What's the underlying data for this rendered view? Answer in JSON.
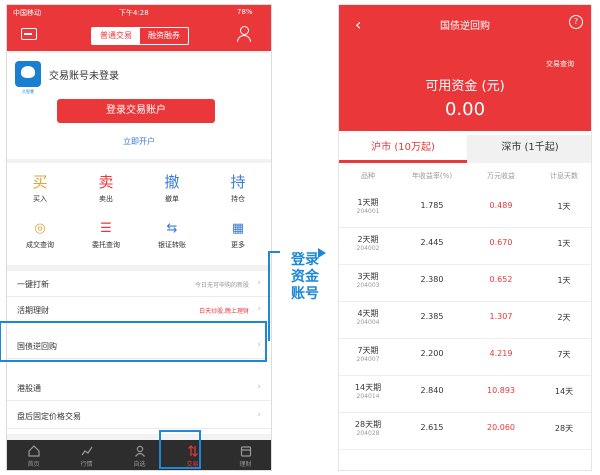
{
  "left": {
    "status": {
      "carrier": "中国移动",
      "time": "下午4:28",
      "battery": "78%"
    },
    "header": {
      "seg_normal": "普通交易",
      "seg_margin": "融资融券"
    },
    "account": {
      "logo_text": "大智慧",
      "title": "交易账号未登录",
      "login_button": "登录交易账户",
      "open_account": "立即开户"
    },
    "grid": [
      {
        "glyph": "买",
        "label": "买入",
        "color": "#e0a43a"
      },
      {
        "glyph": "卖",
        "label": "卖出",
        "color": "#e9373a"
      },
      {
        "glyph": "撤",
        "label": "撤单",
        "color": "#3b79d6"
      },
      {
        "glyph": "持",
        "label": "持仓",
        "color": "#3b79d6"
      },
      {
        "glyph": "◎",
        "label": "成交查询",
        "color": "#e0a43a"
      },
      {
        "glyph": "☰",
        "label": "委托查询",
        "color": "#e9373a"
      },
      {
        "glyph": "⇆",
        "label": "银证转账",
        "color": "#3b79d6"
      },
      {
        "glyph": "▦",
        "label": "更多",
        "color": "#3b79d6"
      }
    ],
    "list": [
      {
        "label": "一键打新",
        "hint": "今日无可申购的新股",
        "hint_red": false
      },
      {
        "label": "活期理财",
        "hint": "白天炒股,晚上理财",
        "hint_red": true
      },
      {
        "label": "国债逆回购",
        "hint": "",
        "hint_red": false
      },
      {
        "label": "港股通",
        "hint": "",
        "hint_red": false
      },
      {
        "label": "盘后固定价格交易",
        "hint": "",
        "hint_red": false
      }
    ],
    "tabs": [
      {
        "label": "首页",
        "icon": "home-icon"
      },
      {
        "label": "行情",
        "icon": "chart-icon"
      },
      {
        "label": "自选",
        "icon": "person-icon"
      },
      {
        "label": "交易",
        "icon": "trade-icon"
      },
      {
        "label": "理财",
        "icon": "wallet-icon"
      }
    ]
  },
  "annotation": {
    "caption_lines": [
      "登录",
      "资金",
      "账号"
    ],
    "accent": "#1e88d6"
  },
  "right": {
    "title": "国债逆回购",
    "help": "?",
    "query": "交易查询",
    "available_label": "可用资金 (元)",
    "available_value": "0.00",
    "market_tabs": [
      "沪市 (10万起)",
      "深市 (1千起)"
    ],
    "columns": [
      "品种",
      "年收益率(%)",
      "万元收益",
      "计息天数"
    ],
    "rows": [
      {
        "name": "1天期",
        "code": "204001",
        "rate": "1.785",
        "profit": "0.489",
        "days": "1天"
      },
      {
        "name": "2天期",
        "code": "204002",
        "rate": "2.445",
        "profit": "0.670",
        "days": "1天"
      },
      {
        "name": "3天期",
        "code": "204003",
        "rate": "2.380",
        "profit": "0.652",
        "days": "1天"
      },
      {
        "name": "4天期",
        "code": "204004",
        "rate": "2.385",
        "profit": "1.307",
        "days": "2天"
      },
      {
        "name": "7天期",
        "code": "204007",
        "rate": "2.200",
        "profit": "4.219",
        "days": "7天"
      },
      {
        "name": "14天期",
        "code": "204014",
        "rate": "2.840",
        "profit": "10.893",
        "days": "14天"
      },
      {
        "name": "28天期",
        "code": "204028",
        "rate": "2.615",
        "profit": "20.060",
        "days": "28天"
      }
    ],
    "accent": "#e9373a"
  }
}
